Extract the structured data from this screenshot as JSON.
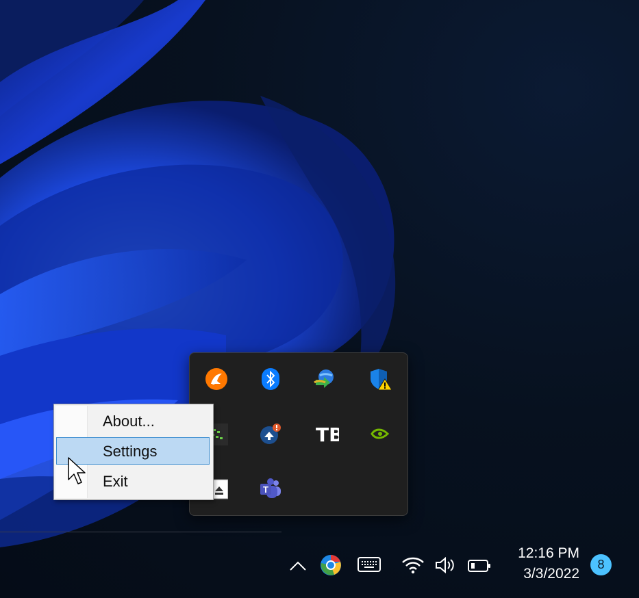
{
  "context_menu": {
    "items": [
      {
        "label": "About..."
      },
      {
        "label": "Settings",
        "selected": true
      },
      {
        "label": "Exit"
      }
    ]
  },
  "tray_flyout": {
    "icons": [
      "avast-icon",
      "bluetooth-icon",
      "internet-download-manager-icon",
      "windows-security-warning-icon",
      "cpu-monitor-icon",
      "update-notifier-icon",
      "tb-app-icon",
      "nvidia-icon",
      "eject-usb-icon",
      "teams-icon"
    ]
  },
  "taskbar": {
    "clock": {
      "time": "12:16 PM",
      "date": "3/3/2022"
    },
    "notification_count": "8",
    "teams_letter": "T",
    "tb_letters": "TB"
  },
  "colors": {
    "accent": "#4cc2ff",
    "menu_highlight": "#bcd9f3",
    "menu_highlight_border": "#3f8fd2"
  }
}
